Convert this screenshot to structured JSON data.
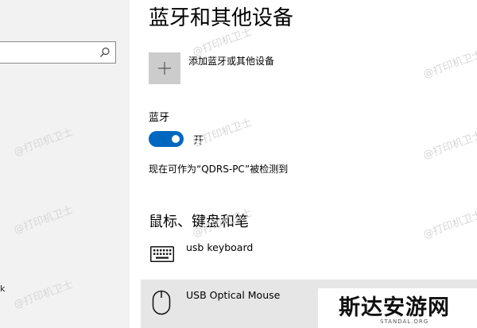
{
  "sidebar": {
    "search": {
      "value": "",
      "placeholder": ""
    },
    "search_icon": "search-icon",
    "partial_item_text": "k"
  },
  "main": {
    "title": "蓝牙和其他设备",
    "add_device": {
      "label": "添加蓝牙或其他设备",
      "icon": "plus-icon"
    },
    "bluetooth": {
      "label": "蓝牙",
      "toggle_on": true,
      "state_label": "开",
      "discoverable_text": "现在可作为“QDRS-PC”被检测到"
    },
    "peripherals": {
      "heading": "鼠标、键盘和笔",
      "devices": [
        {
          "name": "usb keyboard",
          "icon": "keyboard-icon"
        },
        {
          "name": "USB Optical Mouse",
          "icon": "mouse-icon",
          "selected": true
        }
      ]
    }
  },
  "watermark": {
    "text": "@打印机卫士"
  },
  "logo": {
    "text": "斯达安游网",
    "subtext": "STANDAL.ORG"
  },
  "colors": {
    "accent": "#0067c0",
    "sidebar_bg": "#f2f2f2",
    "selected_row": "#e6e6e6",
    "add_tile": "#cccccc",
    "watermark": "#d7d7d7"
  }
}
